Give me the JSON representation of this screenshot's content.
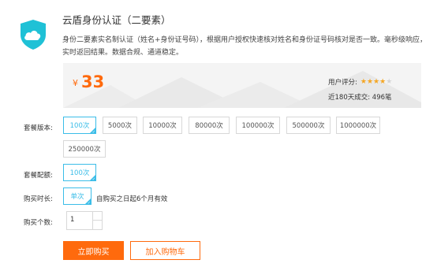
{
  "product": {
    "logo_icon": "cloud-shield-icon",
    "title": "云盾身份认证（二要素）",
    "description": "身份二要素实名制认证（姓名+身份证号码），根据用户授权快速核对姓名和身份证号码核对是否一致。毫秒级响应，实时返回结果。数据合规、通道稳定。"
  },
  "price": {
    "currency_symbol": "¥",
    "amount": "33",
    "rating_label": "用户评分:",
    "rating_value": 4,
    "rating_max": 5,
    "sales_text": "近180天成交: 496笔"
  },
  "package_version": {
    "label": "套餐版本:",
    "options": [
      "100次",
      "5000次",
      "10000次",
      "80000次",
      "100000次",
      "500000次",
      "1000000次",
      "250000次"
    ],
    "selected": "100次"
  },
  "package_config": {
    "label": "套餐配额:",
    "options": [
      "100次"
    ],
    "selected": "100次"
  },
  "duration": {
    "label": "购买时长:",
    "options": [
      "单次"
    ],
    "selected": "单次",
    "note": "自购买之日起6个月有效"
  },
  "quantity": {
    "label": "购买个数:",
    "value": "1"
  },
  "actions": {
    "buy_now": "立即购买",
    "add_to_cart": "加入购物车"
  },
  "colors": {
    "accent": "#ff6a0d",
    "selected": "#3bbde8",
    "logo": "#1fc1d6",
    "star": "#f5a623"
  }
}
